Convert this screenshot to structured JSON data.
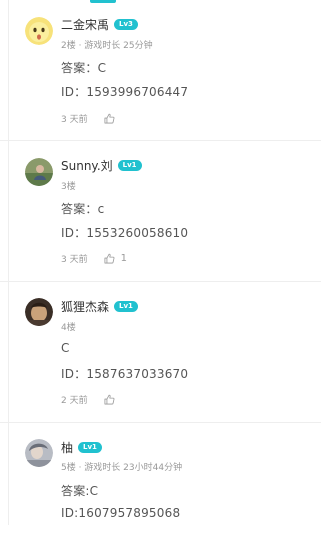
{
  "comments": [
    {
      "username": "二金宋禹",
      "level": "Lv3",
      "meta": "2楼 · 游戏时长 25分钟",
      "lines": [
        "答案：C",
        "ID：1593996706447"
      ],
      "time": "3 天前",
      "likes": ""
    },
    {
      "username": "Sunny.刘",
      "level": "Lv1",
      "meta": "3楼",
      "lines": [
        "答案：c",
        "ID：1553260058610"
      ],
      "time": "3 天前",
      "likes": "1"
    },
    {
      "username": "狐狸杰森",
      "level": "Lv1",
      "meta": "4楼",
      "lines": [
        "C",
        "ID：1587637033670"
      ],
      "time": "2 天前",
      "likes": ""
    },
    {
      "username": "柚",
      "level": "Lv1",
      "meta": "5楼 · 游戏时长 23小时44分钟",
      "lines": [
        "答案:C",
        "ID:1607957895068"
      ],
      "time": "",
      "likes": ""
    }
  ],
  "colors": {
    "accent": "#21c1cf",
    "meta_text": "#999999",
    "body_text": "#555555"
  },
  "icons": [
    "thumbs-up-icon"
  ]
}
